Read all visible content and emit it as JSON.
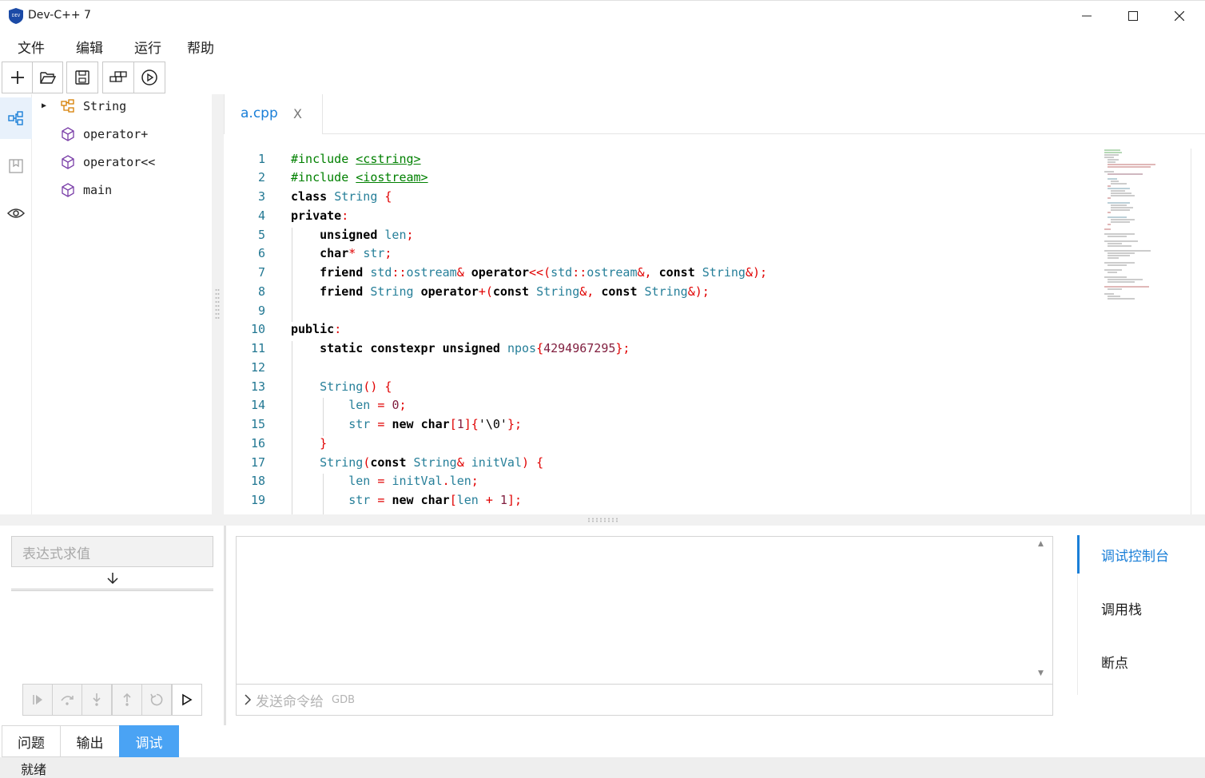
{
  "window": {
    "title": "Dev-C++ 7",
    "logo_text": "DEV",
    "minimize": "—",
    "maximize": "☐",
    "close": "✕"
  },
  "menu": [
    "文件",
    "编辑",
    "运行",
    "帮助"
  ],
  "toolbar": {
    "items": [
      "new-file",
      "open-file",
      "save-file",
      "compile",
      "run"
    ]
  },
  "activity_bar": [
    "outline",
    "bookmarks",
    "watch"
  ],
  "outline": {
    "items": [
      {
        "name": "String",
        "kind": "class",
        "expandable": true
      },
      {
        "name": "operator+",
        "kind": "function"
      },
      {
        "name": "operator<<",
        "kind": "function"
      },
      {
        "name": "main",
        "kind": "function"
      }
    ]
  },
  "editor": {
    "tab_label": "a.cpp",
    "tab_close": "X",
    "lines": [
      "1",
      "2",
      "3",
      "4",
      "5",
      "6",
      "7",
      "8",
      "9",
      "10",
      "11",
      "12",
      "13",
      "14",
      "15",
      "16",
      "17",
      "18",
      "19"
    ]
  },
  "bottom": {
    "expr_placeholder": "表达式求值",
    "gdb_placeholder": "发送命令给",
    "gdb_hint": "GDB",
    "debug_buttons": [
      "continue",
      "step-over",
      "step-into",
      "step-out",
      "restart",
      "start"
    ],
    "side_tabs": [
      "调试控制台",
      "调用栈",
      "断点"
    ],
    "active_side_tab": "调试控制台"
  },
  "panel_tabs": [
    "问题",
    "输出",
    "调试"
  ],
  "active_panel_tab": "调试",
  "status": "就绪",
  "colors": {
    "accent": "#1a7fd8",
    "active_tab": "#4aa3f4",
    "keyword_green": "#008000",
    "type_teal": "#267f99",
    "operator_red": "#e00000",
    "line_number": "#237893"
  }
}
